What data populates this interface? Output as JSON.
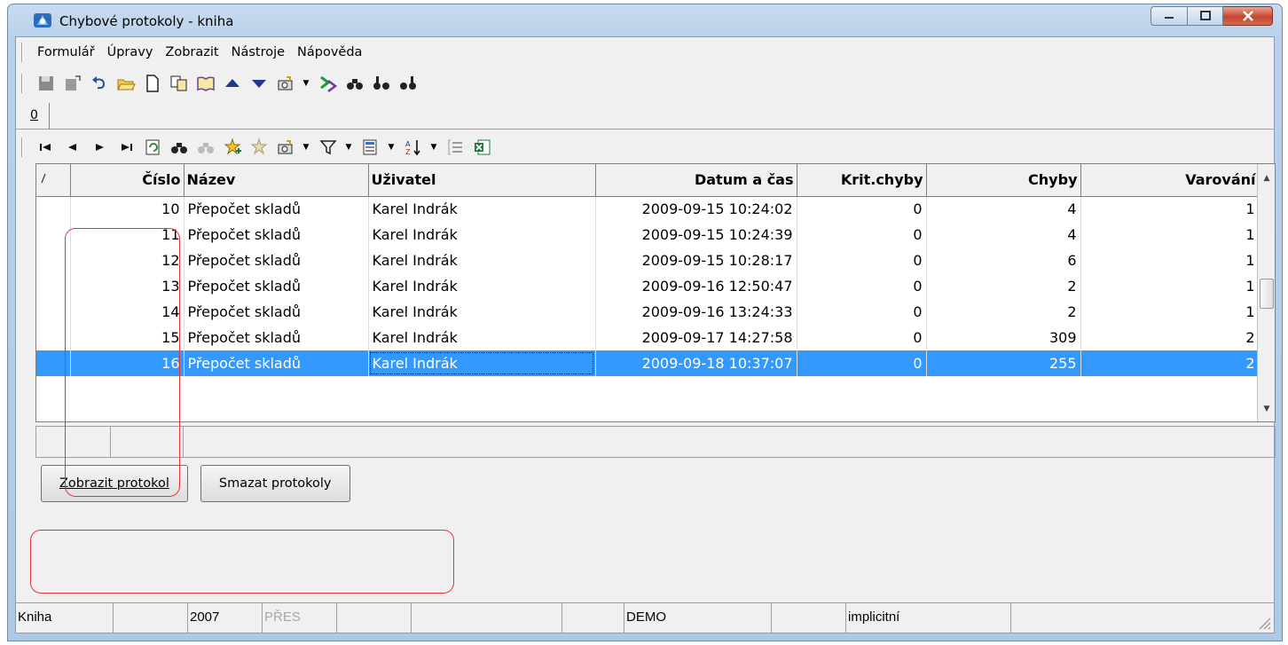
{
  "window": {
    "title": "Chybové protokoly - kniha"
  },
  "menu": [
    "Formulář",
    "Úpravy",
    "Zobrazit",
    "Nástroje",
    "Nápověda"
  ],
  "tabs": [
    "0"
  ],
  "grid": {
    "columns": [
      "Číslo",
      "Název",
      "Uživatel",
      "Datum a čas",
      "Krit.chyby",
      "Chyby",
      "Varování"
    ],
    "rows": [
      [
        "10",
        "Přepočet skladů",
        "Karel Indrák",
        "2009-09-15 10:24:02",
        "0",
        "4",
        "1"
      ],
      [
        "11",
        "Přepočet skladů",
        "Karel Indrák",
        "2009-09-15 10:24:39",
        "0",
        "4",
        "1"
      ],
      [
        "12",
        "Přepočet skladů",
        "Karel Indrák",
        "2009-09-15 10:28:17",
        "0",
        "6",
        "1"
      ],
      [
        "13",
        "Přepočet skladů",
        "Karel Indrák",
        "2009-09-16 12:50:47",
        "0",
        "2",
        "1"
      ],
      [
        "14",
        "Přepočet skladů",
        "Karel Indrák",
        "2009-09-16 13:24:33",
        "0",
        "2",
        "1"
      ],
      [
        "15",
        "Přepočet skladů",
        "Karel Indrák",
        "2009-09-17 14:27:58",
        "0",
        "309",
        "2"
      ],
      [
        "16",
        "Přepočet skladů",
        "Karel Indrák",
        "2009-09-18 10:37:07",
        "0",
        "255",
        "2"
      ]
    ],
    "selected_row": 6
  },
  "buttons": {
    "show_protocol": "Zobrazit protokol",
    "delete_protocols": "Smazat protokoly"
  },
  "status": {
    "book": "Kniha",
    "year": "2007",
    "mode": "PŘES",
    "db": "DEMO",
    "profile": "implicitní"
  },
  "colors": {
    "selection": "#3399ff",
    "annotation": "#e8323c"
  }
}
